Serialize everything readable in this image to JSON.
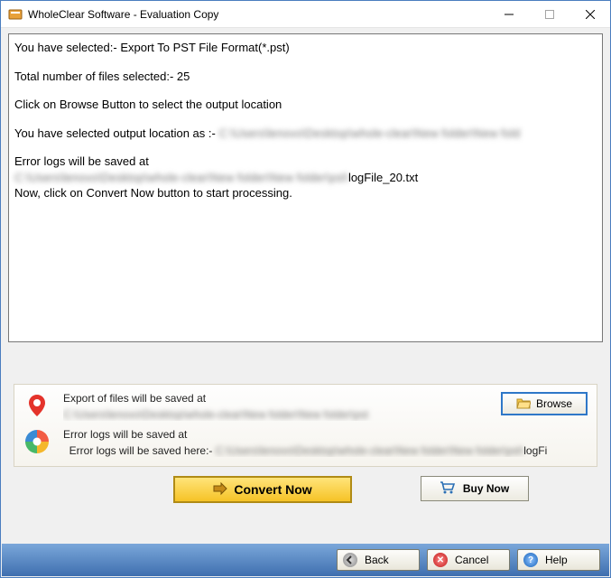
{
  "titlebar": {
    "title": "WholeClear Software - Evaluation Copy"
  },
  "log": {
    "line1": "You have selected:- Export To PST File Format(*.pst)",
    "line2": "Total number of files selected:- 25",
    "line3": "Click on Browse Button to select the output location",
    "line4_prefix": "You have selected output location as :- ",
    "line4_blur": "C:\\Users\\lenovo\\Desktop\\whole-clear\\New folder\\New fold",
    "line5": "Error logs will be saved at",
    "line6_blur": "C:\\Users\\lenovo\\Desktop\\whole-clear\\New folder\\New folder\\pst\\",
    "line6_suffix": "logFile_20.txt",
    "line7": "Now, click on Convert Now button to start processing."
  },
  "info": {
    "export_label": "Export of files will be saved at",
    "export_path_blur": "C:\\Users\\lenovo\\Desktop\\whole-clear\\New folder\\New folder\\pst",
    "errors_label": "Error logs will be saved at",
    "errors_prefix": "Error logs will be saved here:- ",
    "errors_path_blur": "C:\\Users\\lenovo\\Desktop\\whole-clear\\New folder\\New folder\\pst\\",
    "errors_suffix": "logFi"
  },
  "buttons": {
    "browse": "Browse",
    "convert": "Convert Now",
    "buy": "Buy Now",
    "back": "Back",
    "cancel": "Cancel",
    "help": "Help"
  }
}
